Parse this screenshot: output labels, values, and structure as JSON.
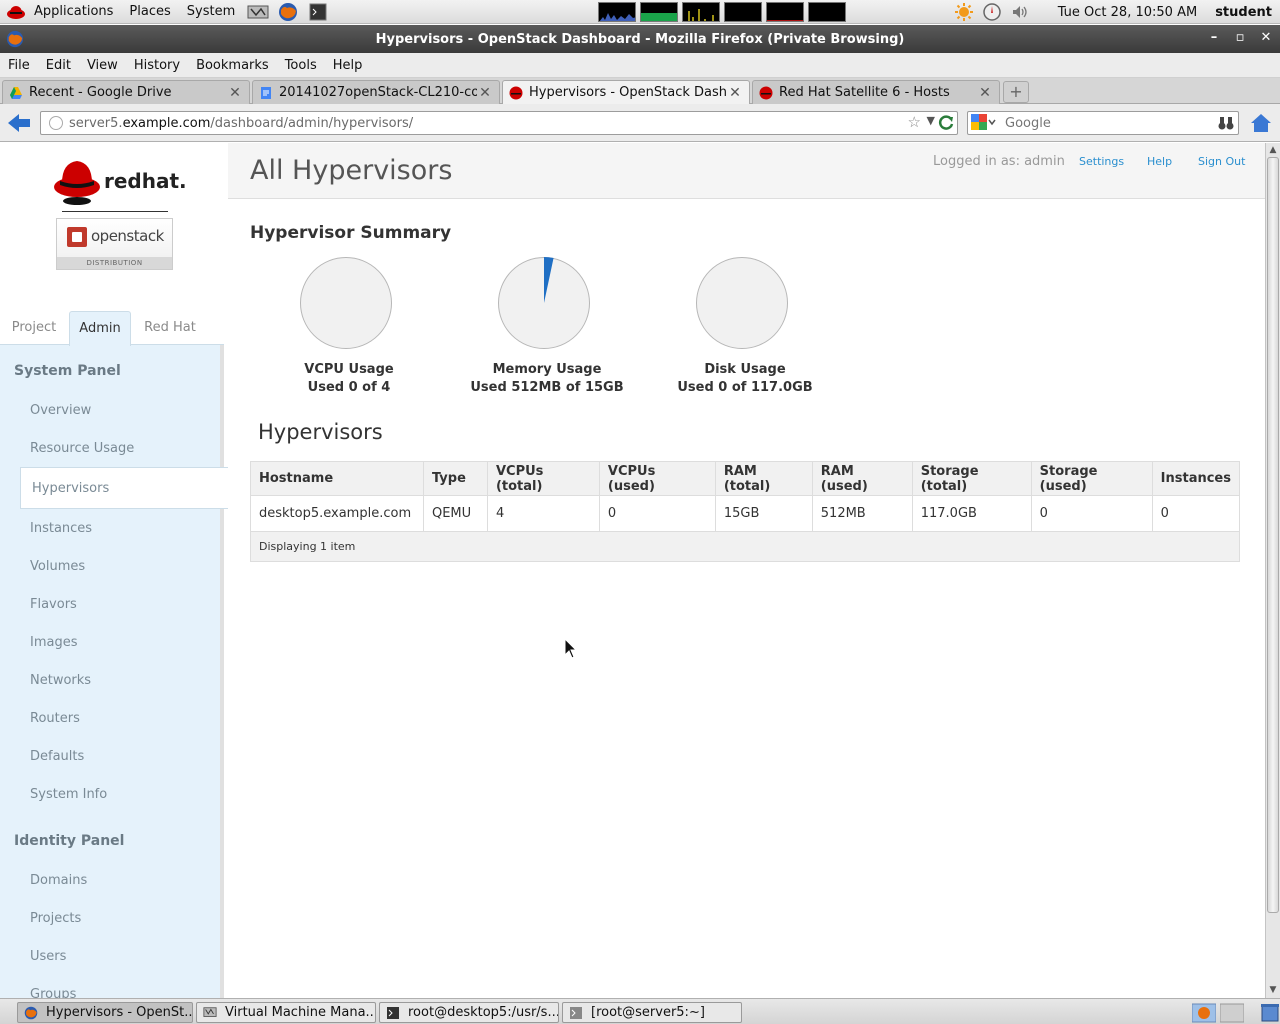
{
  "gnome_panel": {
    "menus": [
      "Applications",
      "Places",
      "System"
    ],
    "clock": "Tue Oct 28, 10:50 AM",
    "user": "student"
  },
  "window": {
    "title": "Hypervisors - OpenStack Dashboard - Mozilla Firefox (Private Browsing)"
  },
  "menubar": [
    "File",
    "Edit",
    "View",
    "History",
    "Bookmarks",
    "Tools",
    "Help"
  ],
  "tabs": [
    {
      "label": "Recent - Google Drive"
    },
    {
      "label": "20141027openStack-CL210-cou..."
    },
    {
      "label": "Hypervisors - OpenStack Dash..."
    },
    {
      "label": "Red Hat Satellite 6 - Hosts"
    }
  ],
  "navbar": {
    "url_prefix": "server5.",
    "url_host": "example.com",
    "url_path": "/dashboard/admin/hypervisors/",
    "search_placeholder": "Google"
  },
  "brand": {
    "redhat": "redhat.",
    "openstack": "openstack",
    "distribution": "DISTRIBUTION"
  },
  "sidebar": {
    "tabs": [
      "Project",
      "Admin",
      "Red Hat"
    ],
    "system_panel": "System Panel",
    "system_items": [
      "Overview",
      "Resource Usage",
      "Hypervisors",
      "Instances",
      "Volumes",
      "Flavors",
      "Images",
      "Networks",
      "Routers",
      "Defaults",
      "System Info"
    ],
    "identity_panel": "Identity Panel",
    "identity_items": [
      "Domains",
      "Projects",
      "Users",
      "Groups"
    ]
  },
  "header": {
    "title": "All Hypervisors",
    "logged_in": "Logged in as: admin",
    "settings": "Settings",
    "help": "Help",
    "sign_out": "Sign Out"
  },
  "summary": {
    "title": "Hypervisor Summary",
    "charts": [
      {
        "label": "VCPU Usage",
        "detail": "Used 0 of 4",
        "used": 0,
        "total": 4
      },
      {
        "label": "Memory Usage",
        "detail": "Used 512MB of 15GB",
        "used": 0.5,
        "total": 15
      },
      {
        "label": "Disk Usage",
        "detail": "Used 0 of 117.0GB",
        "used": 0,
        "total": 117.0
      }
    ],
    "pie_color": "#1f6fc4"
  },
  "table": {
    "title": "Hypervisors",
    "columns": [
      "Hostname",
      "Type",
      "VCPUs (total)",
      "VCPUs (used)",
      "RAM (total)",
      "RAM (used)",
      "Storage (total)",
      "Storage (used)",
      "Instances"
    ],
    "rows": [
      [
        "desktop5.example.com",
        "QEMU",
        "4",
        "0",
        "15GB",
        "512MB",
        "117.0GB",
        "0",
        "0"
      ]
    ],
    "footer": "Displaying 1 item"
  },
  "taskbar": [
    {
      "label": "Hypervisors - OpenSt..."
    },
    {
      "label": "Virtual Machine Mana..."
    },
    {
      "label": "root@desktop5:/usr/s..."
    },
    {
      "label": "[root@server5:~]"
    }
  ]
}
